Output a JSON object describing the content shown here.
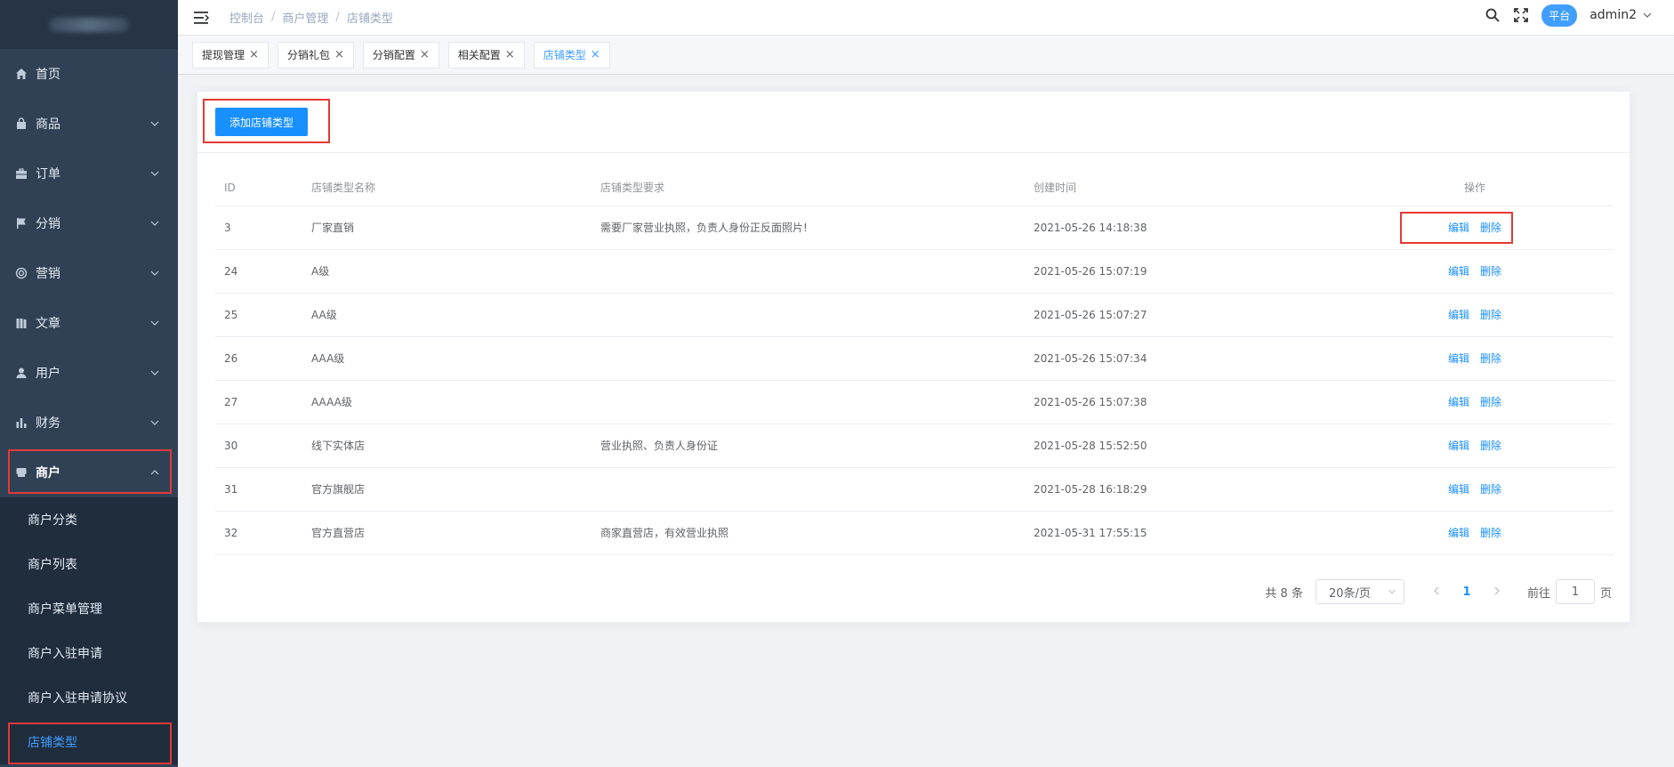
{
  "sidebar": {
    "items": [
      {
        "label": "首页",
        "icon": "home-icon"
      },
      {
        "label": "商品",
        "icon": "bag-icon"
      },
      {
        "label": "订单",
        "icon": "briefcase-icon"
      },
      {
        "label": "分销",
        "icon": "flag-icon"
      },
      {
        "label": "营销",
        "icon": "lifebuoy-icon"
      },
      {
        "label": "文章",
        "icon": "book-icon"
      },
      {
        "label": "用户",
        "icon": "user-icon"
      },
      {
        "label": "财务",
        "icon": "bar-chart-icon"
      },
      {
        "label": "商户",
        "icon": "store-icon"
      }
    ],
    "submenu": [
      {
        "label": "商户分类"
      },
      {
        "label": "商户列表"
      },
      {
        "label": "商户菜单管理"
      },
      {
        "label": "商户入驻申请"
      },
      {
        "label": "商户入驻申请协议"
      },
      {
        "label": "店铺类型"
      }
    ]
  },
  "header": {
    "breadcrumb": [
      "控制台",
      "商户管理",
      "店铺类型"
    ],
    "role_badge": "平台",
    "username": "admin2"
  },
  "tags": [
    "提现管理",
    "分销礼包",
    "分销配置",
    "相关配置",
    "店铺类型"
  ],
  "toolbar": {
    "add_label": "添加店铺类型"
  },
  "table": {
    "columns": [
      "ID",
      "店铺类型名称",
      "店铺类型要求",
      "创建时间",
      "操作"
    ],
    "rows": [
      {
        "id": "3",
        "name": "厂家直销",
        "req": "需要厂家营业执照，负责人身份正反面照片!",
        "time": "2021-05-26 14:18:38"
      },
      {
        "id": "24",
        "name": "A级",
        "req": "",
        "time": "2021-05-26 15:07:19"
      },
      {
        "id": "25",
        "name": "AA级",
        "req": "",
        "time": "2021-05-26 15:07:27"
      },
      {
        "id": "26",
        "name": "AAA级",
        "req": "",
        "time": "2021-05-26 15:07:34"
      },
      {
        "id": "27",
        "name": "AAAA级",
        "req": "",
        "time": "2021-05-26 15:07:38"
      },
      {
        "id": "30",
        "name": "线下实体店",
        "req": "营业执照、负责人身份证",
        "time": "2021-05-28 15:52:50"
      },
      {
        "id": "31",
        "name": "官方旗舰店",
        "req": "",
        "time": "2021-05-28 16:18:29"
      },
      {
        "id": "32",
        "name": "官方直营店",
        "req": "商家直营店，有效营业执照",
        "time": "2021-05-31 17:55:15"
      }
    ],
    "edit_label": "编辑",
    "delete_label": "删除"
  },
  "pagination": {
    "total": "共 8 条",
    "page_size": "20条/页",
    "current_page": "1",
    "goto_prefix": "前往",
    "goto_value": "1",
    "goto_suffix": "页"
  },
  "colors": {
    "accent": "#1890ff",
    "sidebar_bg": "#304156",
    "submenu_bg": "#1f2d3d",
    "highlight_box": "#e53935"
  }
}
